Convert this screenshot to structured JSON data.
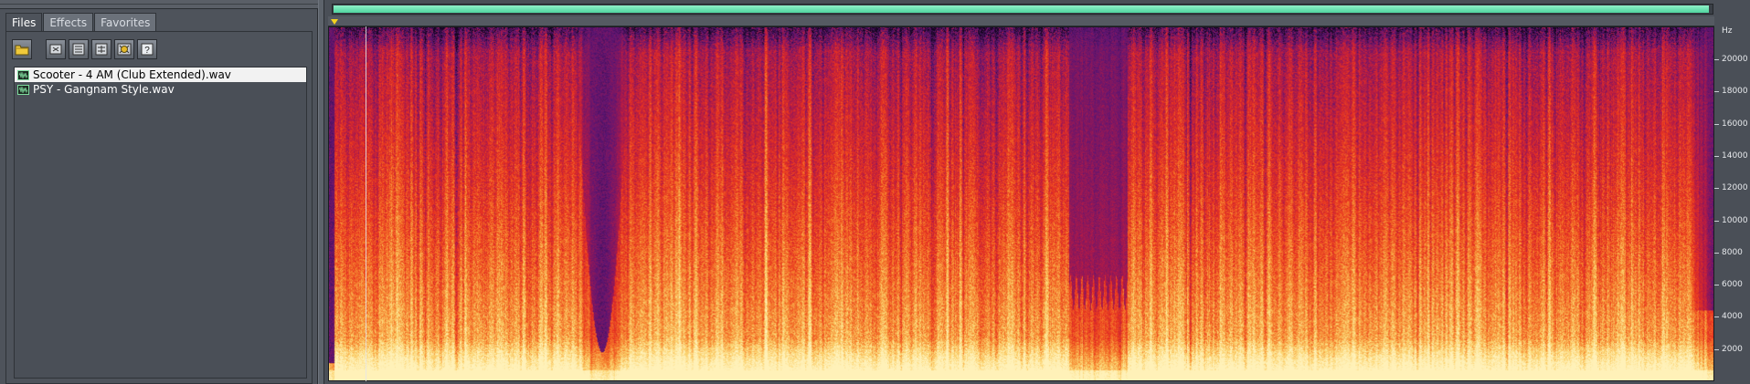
{
  "tabs": [
    {
      "label": "Files",
      "active": true
    },
    {
      "label": "Effects",
      "active": false
    },
    {
      "label": "Favorites",
      "active": false
    }
  ],
  "toolbar": {
    "buttons": [
      {
        "icon": "open-folder-icon"
      },
      {
        "icon": "close-file-icon"
      },
      {
        "icon": "close-all-icon"
      },
      {
        "icon": "close-unmodified-icon"
      },
      {
        "icon": "auto-play-icon"
      },
      {
        "icon": "help-icon"
      }
    ]
  },
  "files": [
    {
      "name": "Scooter - 4 AM (Club Extended).wav",
      "selected": true
    },
    {
      "name": "PSY - Gangnam Style.wav",
      "selected": false
    }
  ],
  "overview": {
    "visible_fraction": 0.998,
    "color": "#4fd49f"
  },
  "spectral_view": {
    "unit_label": "Hz",
    "frequency_ticks": [
      "20000",
      "18000",
      "16000",
      "14000",
      "12000",
      "10000",
      "8000",
      "6000",
      "4000",
      "2000"
    ],
    "max_frequency_hz": 22050,
    "colormap": [
      "#14061e",
      "#5b1574",
      "#b31a47",
      "#e8321f",
      "#f57d2b",
      "#fbd06a",
      "#fff1b8"
    ],
    "cursor_position_fraction": 0.027
  }
}
